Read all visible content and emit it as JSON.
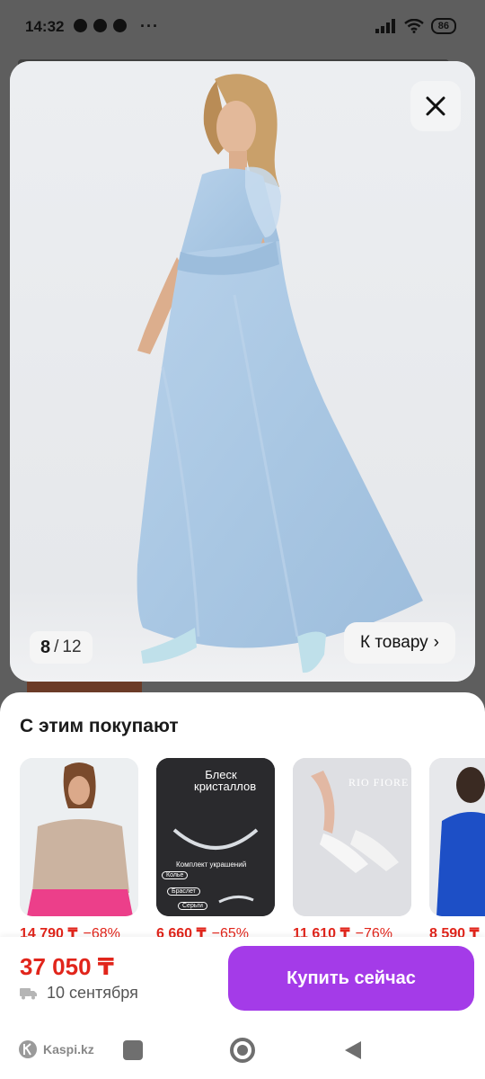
{
  "status_bar": {
    "time": "14:32",
    "battery": "86"
  },
  "viewer": {
    "counter_current": "8",
    "counter_separator": "/",
    "counter_total": "12",
    "to_product_label": "К товару",
    "to_product_chevron": "›"
  },
  "recommendations": {
    "title": "С этим покупают",
    "items": [
      {
        "price": "14 790 ₸",
        "discount": "−68%",
        "image": "sequin-top-photo"
      },
      {
        "price": "6 660 ₸",
        "discount": "−65%",
        "image": "jewelry-set-photo",
        "overlay_title": "Блеск кристаллов",
        "overlay_subtitle": "Комплект украшений",
        "tags": [
          "Колье",
          "Браслет",
          "Серьги"
        ]
      },
      {
        "price": "11 610 ₸",
        "discount": "−76%",
        "image": "white-heels-photo",
        "brand_overlay": "RIO FIORE"
      },
      {
        "price": "8 590 ₸",
        "discount": "",
        "image": "blue-sequin-dress-photo"
      }
    ]
  },
  "buy_bar": {
    "price": "37 050 ₸",
    "delivery_date": "10 сентября",
    "buy_label": "Купить сейчас"
  },
  "nav": {
    "brand": "Kaspi.kz"
  },
  "colors": {
    "price_red": "#e1251b",
    "accent_purple": "#a43be8",
    "dress_blue": "#a9c7e3"
  }
}
